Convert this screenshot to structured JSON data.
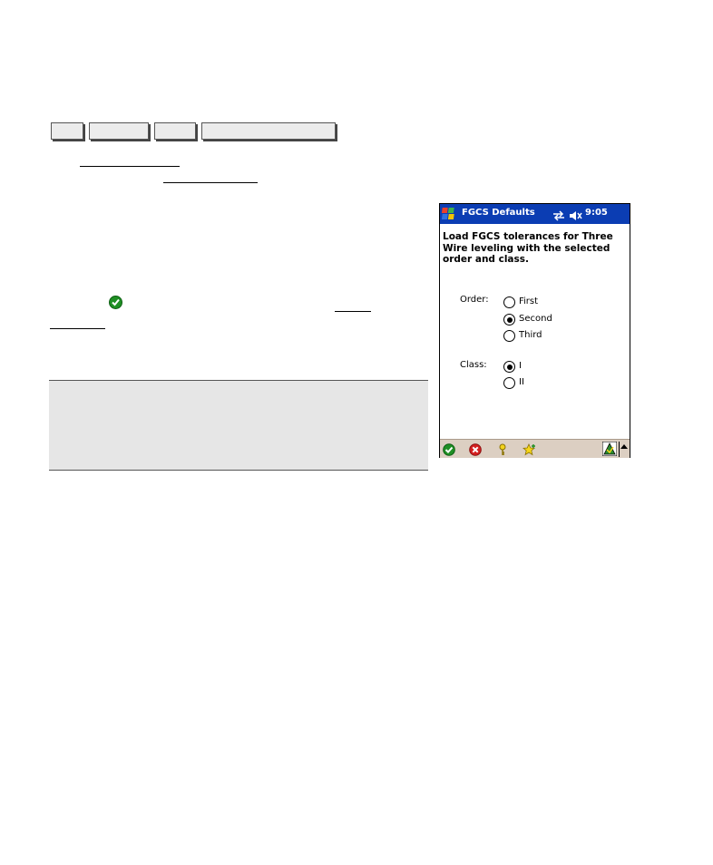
{
  "window": {
    "title": "FGCS Defaults",
    "time": "9:05"
  },
  "description": "Load FGCS tolerances for Three Wire  leveling with the selected order and class.",
  "order": {
    "label": "Order:",
    "options": [
      "First",
      "Second",
      "Third"
    ],
    "selected": "Second"
  },
  "class": {
    "label": "Class:",
    "options": [
      "I",
      "II"
    ],
    "selected": "I"
  },
  "icons": {
    "start": "windows-start-icon",
    "sync": "sync-arrows-icon",
    "sound": "speaker-muted-icon",
    "ok": "green-check-icon",
    "cancel": "red-x-icon",
    "help": "key-help-icon",
    "favorites": "star-icon",
    "input": "input-panel-icon"
  },
  "colors": {
    "titlebar": "#0b3db3",
    "command_bar": "#dccfc2",
    "ok_green": "#1f8f24",
    "cancel_red": "#d42020",
    "note_box": "#e6e6e6"
  }
}
